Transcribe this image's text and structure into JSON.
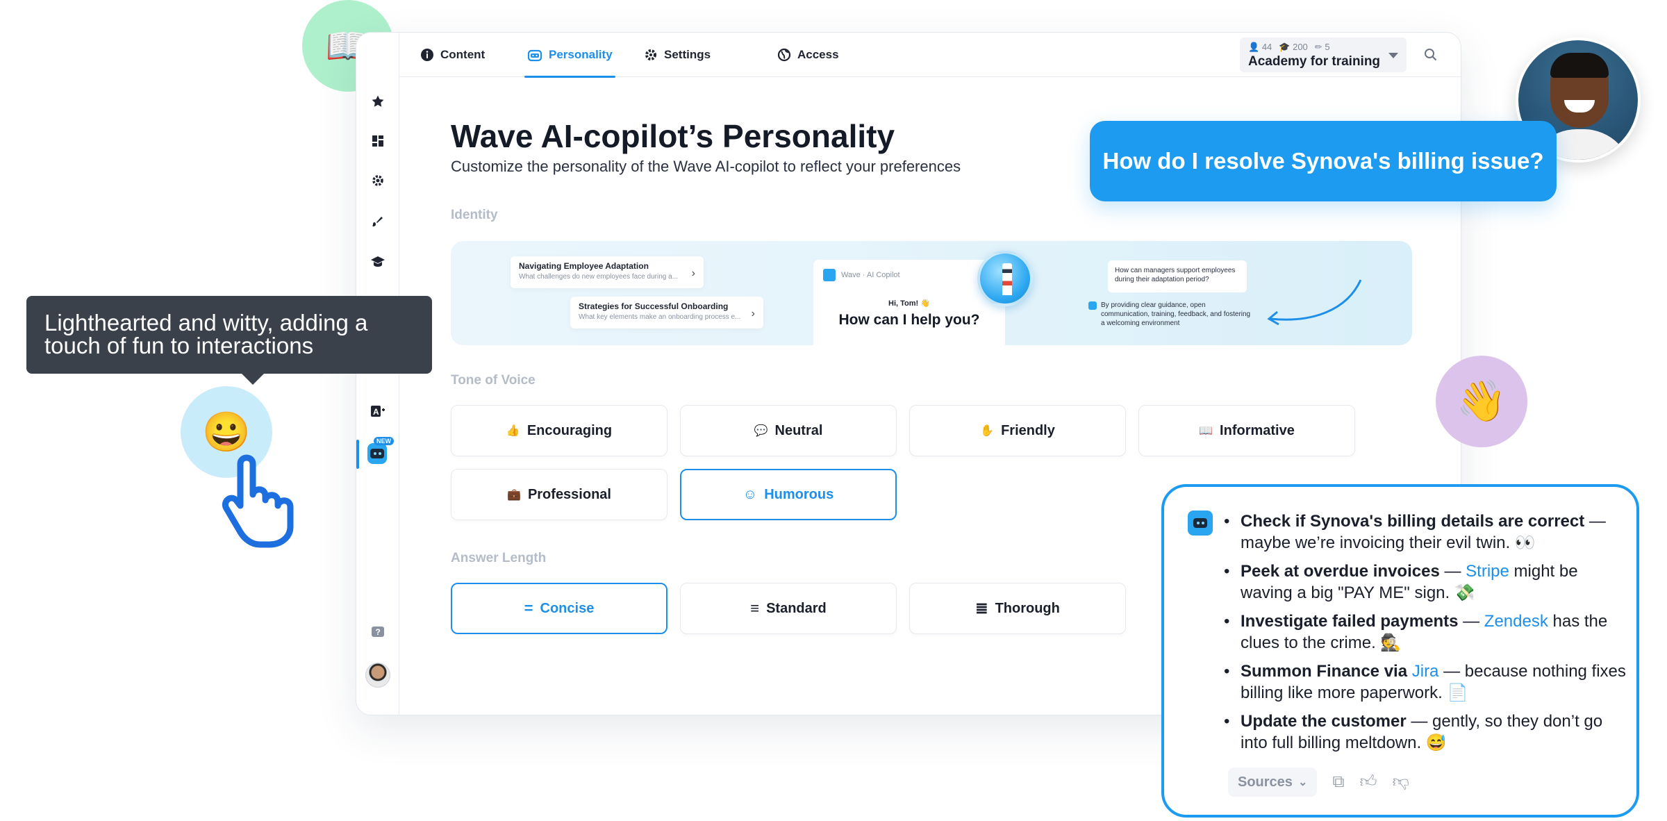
{
  "tabs": [
    {
      "label": "Content",
      "icon": "info-icon"
    },
    {
      "label": "Personality",
      "icon": "robot-icon",
      "active": true
    },
    {
      "label": "Settings",
      "icon": "gear-icon"
    },
    {
      "label": "Access",
      "icon": "globe-icon"
    }
  ],
  "org": {
    "members": "44",
    "courses": "200",
    "editors": "5",
    "name": "Academy for training"
  },
  "page": {
    "title": "Wave AI-copilot’s Personality",
    "subtitle": "Customize the personality of the Wave AI-copilot to reflect your preferences"
  },
  "identity": {
    "label": "Identity",
    "card1_title": "Navigating Employee Adaptation",
    "card1_sub": "What challenges do new employees face during a...",
    "card2_title": "Strategies for Successful Onboarding",
    "card2_sub": "What key elements make an onboarding process e...",
    "copilot_header": "Wave · AI Copilot",
    "greeting": "Hi, Tom! 👋",
    "help": "How can I help you?",
    "question": "How can managers support employees during their adaptation period?",
    "answer": "By providing clear guidance, open communication, training, feedback, and fostering a welcoming environment"
  },
  "tone": {
    "label": "Tone of Voice",
    "options": [
      {
        "label": "Encouraging",
        "icon": "👍"
      },
      {
        "label": "Neutral",
        "icon": "💬"
      },
      {
        "label": "Friendly",
        "icon": "✋"
      },
      {
        "label": "Informative",
        "icon": "📖"
      },
      {
        "label": "Professional",
        "icon": "💼"
      },
      {
        "label": "Humorous",
        "icon": "☺",
        "selected": true
      }
    ]
  },
  "length": {
    "label": "Answer Length",
    "options": [
      {
        "label": "Concise",
        "icon": "=",
        "selected": true
      },
      {
        "label": "Standard",
        "icon": "≡"
      },
      {
        "label": "Thorough",
        "icon": "≣"
      }
    ]
  },
  "tooltip": "Lighthearted and witty, adding a touch of fun to interactions",
  "user_question": "How do I resolve Synova's billing issue?",
  "answer": {
    "items": [
      {
        "bold": "Check if Synova's billing details are correct",
        "pre": "",
        "link": "",
        "rest": " — maybe we’re invoicing their evil twin. 👀"
      },
      {
        "bold": "Peek at overdue invoices",
        "pre": " — ",
        "link": "Stripe",
        "rest": " might be waving a big \"PAY ME\" sign. 💸"
      },
      {
        "bold": "Investigate failed payments",
        "pre": " — ",
        "link": "Zendesk",
        "rest": " has the clues to the crime. 🕵️"
      },
      {
        "bold": "Summon Finance via",
        "pre": " ",
        "link": "Jira",
        "rest": " — because nothing fixes billing like more paperwork. 📄"
      },
      {
        "bold": "Update the customer",
        "pre": "",
        "link": "",
        "rest": " — gently, so they don’t go into full billing meltdown. 😅"
      }
    ],
    "sources_label": "Sources"
  },
  "decor": {
    "book": "📖",
    "smile": "😀",
    "wave": "👋"
  }
}
